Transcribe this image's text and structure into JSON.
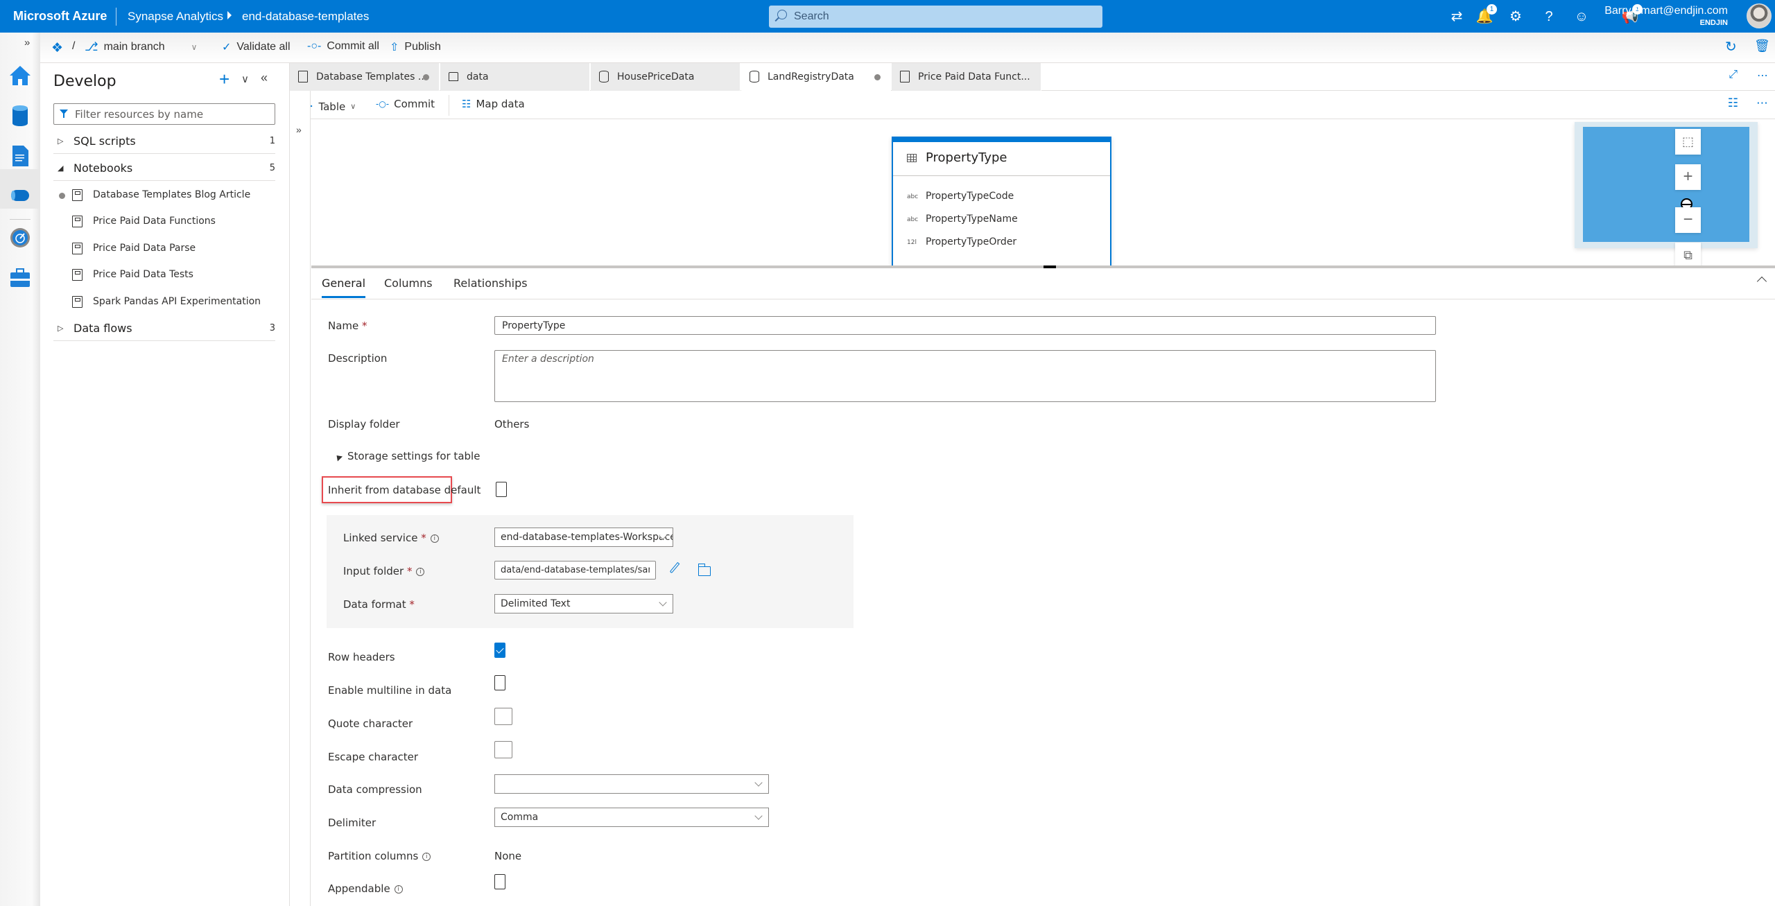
{
  "topbar": {
    "brand": "Microsoft Azure",
    "breadcrumb": [
      "Synapse Analytics",
      "end-database-templates"
    ],
    "search_placeholder": "Search",
    "icons": [
      {
        "name": "feedback-icon",
        "badge": "1"
      },
      {
        "name": "directory-switch-icon",
        "badge": null
      },
      {
        "name": "notifications-icon",
        "badge": "1"
      },
      {
        "name": "settings-icon",
        "badge": null
      },
      {
        "name": "help-icon",
        "badge": null
      },
      {
        "name": "user-feedback-icon",
        "badge": null
      }
    ],
    "user": {
      "email": "Barry.Smart@endjin.com",
      "org": "ENDJIN"
    }
  },
  "cmdbar": {
    "separator": "/",
    "branch": "main branch",
    "validate_all": "Validate all",
    "commit_all": "Commit all",
    "publish": "Publish"
  },
  "develop": {
    "title": "Develop",
    "filter_placeholder": "Filter resources by name",
    "groups": [
      {
        "label": "SQL scripts",
        "count": "1",
        "expanded": false
      },
      {
        "label": "Notebooks",
        "count": "5",
        "expanded": true,
        "items": [
          {
            "label": "Database Templates Blog Article",
            "modified": true
          },
          {
            "label": "Price Paid Data Functions",
            "modified": false
          },
          {
            "label": "Price Paid Data Parse",
            "modified": false
          },
          {
            "label": "Price Paid Data Tests",
            "modified": false
          },
          {
            "label": "Spark Pandas API Experimentation",
            "modified": false
          }
        ]
      },
      {
        "label": "Data flows",
        "count": "3",
        "expanded": false
      }
    ]
  },
  "tabs": [
    {
      "label": "Database Templates ...",
      "icon": "notebook-icon",
      "modified": true,
      "active": false
    },
    {
      "label": "data",
      "icon": "lake-database-icon",
      "modified": false,
      "active": false
    },
    {
      "label": "HousePriceData",
      "icon": "database-icon",
      "modified": false,
      "active": false
    },
    {
      "label": "LandRegistryData",
      "icon": "database-icon",
      "modified": true,
      "active": true
    },
    {
      "label": "Price Paid Data Funct...",
      "icon": "notebook-icon",
      "modified": false,
      "active": false
    }
  ],
  "editor_toolbar": {
    "table": "Table",
    "commit": "Commit",
    "map_data": "Map data"
  },
  "canvas": {
    "entity": {
      "name": "PropertyType",
      "columns": [
        {
          "type": "abc",
          "name": "PropertyTypeCode"
        },
        {
          "type": "abc",
          "name": "PropertyTypeName"
        },
        {
          "type": "12l",
          "name": "PropertyTypeOrder"
        }
      ]
    }
  },
  "properties": {
    "tabs": [
      "General",
      "Columns",
      "Relationships"
    ],
    "active_tab": "General",
    "name_label": "Name",
    "name_value": "PropertyType",
    "description_label": "Description",
    "description_placeholder": "Enter a description",
    "display_folder_label": "Display folder",
    "display_folder_value": "Others",
    "storage_section": "Storage settings for table",
    "inherit_label": "Inherit from database default",
    "inherit_checked": false,
    "linked_service_label": "Linked service",
    "linked_service_value": "end-database-templates-WorkspaceDefaultStorag...",
    "input_folder_label": "Input folder",
    "input_folder_value": "data/end-database-templates/samples/Propert...",
    "data_format_label": "Data format",
    "data_format_value": "Delimited Text",
    "row_headers_label": "Row headers",
    "row_headers_checked": true,
    "multiline_label": "Enable multiline in data",
    "multiline_checked": false,
    "quote_label": "Quote character",
    "quote_value": "",
    "escape_label": "Escape character",
    "escape_value": "",
    "compression_label": "Data compression",
    "compression_value": "",
    "delimiter_label": "Delimiter",
    "delimiter_value": "Comma",
    "partition_label": "Partition columns",
    "partition_value": "None",
    "appendable_label": "Appendable",
    "appendable_checked": false,
    "required_mark": "*"
  }
}
